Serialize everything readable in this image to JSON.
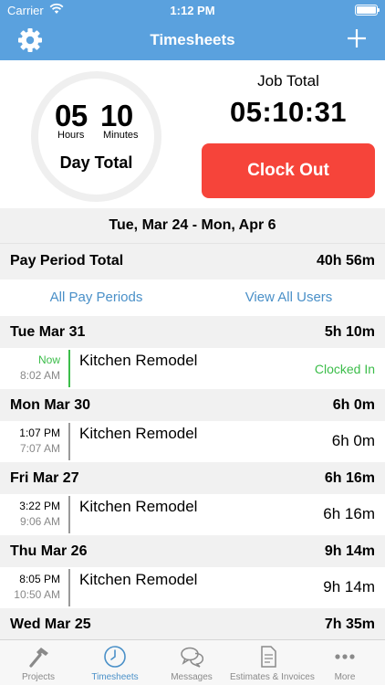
{
  "status_bar": {
    "carrier": "Carrier",
    "time": "1:12 PM"
  },
  "nav": {
    "title": "Timesheets"
  },
  "day_clock": {
    "hours": "05",
    "hours_label": "Hours",
    "minutes": "10",
    "minutes_label": "Minutes",
    "label": "Day Total"
  },
  "job": {
    "label": "Job Total",
    "time": "05:10:31",
    "clock_out_label": "Clock Out"
  },
  "period": {
    "range": "Tue, Mar 24 - Mon, Apr 6",
    "total_label": "Pay Period Total",
    "total_value": "40h 56m",
    "all_periods_link": "All Pay Periods",
    "all_users_link": "View All Users"
  },
  "days": [
    {
      "date": "Tue Mar 31",
      "total": "5h 10m",
      "entries": [
        {
          "start": "Now",
          "end": "8:02 AM",
          "project": "Kitchen Remodel",
          "status": "Clocked In"
        }
      ]
    },
    {
      "date": "Mon Mar 30",
      "total": "6h 0m",
      "entries": [
        {
          "start": "1:07 PM",
          "end": "7:07 AM",
          "project": "Kitchen Remodel",
          "duration": "6h 0m"
        }
      ]
    },
    {
      "date": "Fri Mar 27",
      "total": "6h 16m",
      "entries": [
        {
          "start": "3:22 PM",
          "end": "9:06 AM",
          "project": "Kitchen Remodel",
          "duration": "6h 16m"
        }
      ]
    },
    {
      "date": "Thu Mar 26",
      "total": "9h 14m",
      "entries": [
        {
          "start": "8:05 PM",
          "end": "10:50 AM",
          "project": "Kitchen Remodel",
          "duration": "9h 14m"
        }
      ]
    },
    {
      "date": "Wed Mar 25",
      "total": "7h 35m"
    }
  ],
  "tabbar": [
    {
      "label": "Projects",
      "icon": "hammer-icon"
    },
    {
      "label": "Timesheets",
      "icon": "clock-icon",
      "active": true
    },
    {
      "label": "Messages",
      "icon": "chat-bubbles-icon"
    },
    {
      "label": "Estimates & Invoices",
      "icon": "document-icon"
    },
    {
      "label": "More",
      "icon": "more-dots-icon"
    }
  ],
  "colors": {
    "header": "#5aa1de",
    "clock_out": "#f6443a",
    "active_green": "#3cbd4a",
    "link_blue": "#4a90c8"
  }
}
